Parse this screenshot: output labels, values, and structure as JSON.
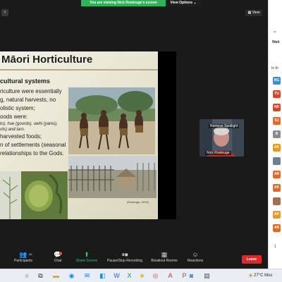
{
  "share_banner": {
    "message": "You are viewing Nick Roskruge's screen",
    "options_label": "View Options ⌄"
  },
  "view_button": {
    "label": "View"
  },
  "slide": {
    "title": "Māori Horticulture",
    "heading": "cultural systems",
    "lines": [
      "riculture  were  essentially",
      "",
      "g,  natural  harvests,  no",
      "olistic system;",
      "oods were:"
    ],
    "italic_lines": [
      "to), hue (gourds), uwhi (yams),",
      "ots) and taro."
    ],
    "lines2": [
      "harvested foods;",
      "n of settlements (seasonal",
      "relationships to the Gods."
    ],
    "photo_credit": "(Roskruge, 2014)"
  },
  "video": {
    "overlay_label": "Remove Spotlight",
    "name": "Nick Roskruge"
  },
  "toolbar": {
    "participants_label": "Participants",
    "participants_count": "66",
    "chat_label": "Chat",
    "chat_badge": "1",
    "share_label": "Share Screen",
    "record_label": "Pause/Stop Recording",
    "breakout_label": "Breakout Rooms",
    "reactions_label": "Reactions",
    "leave_label": "Leave"
  },
  "panel": {
    "waiting_label": "Wait",
    "in_meeting_label": "In th",
    "avatars": [
      {
        "initials": "NG",
        "color": "#3a8fd6"
      },
      {
        "initials": "TU",
        "color": "#d9442c"
      },
      {
        "initials": "NR",
        "color": "#d9442c"
      },
      {
        "initials": "SJ",
        "color": "#e06a2a"
      },
      {
        "initials": "B",
        "color": "#8a8a8a"
      },
      {
        "initials": "AK",
        "color": "#e89a20"
      },
      {
        "initials": "",
        "color": "#6d7f92"
      },
      {
        "initials": "AB",
        "color": "#e06a2a"
      },
      {
        "initials": "AK",
        "color": "#e06a2a"
      },
      {
        "initials": "",
        "color": "#a56d4f"
      },
      {
        "initials": "AK",
        "color": "#e89a20"
      },
      {
        "initials": "AB",
        "color": "#e06a2a"
      }
    ],
    "bottom_value": "1"
  },
  "taskbar": {
    "weather": "27°C Mos"
  }
}
